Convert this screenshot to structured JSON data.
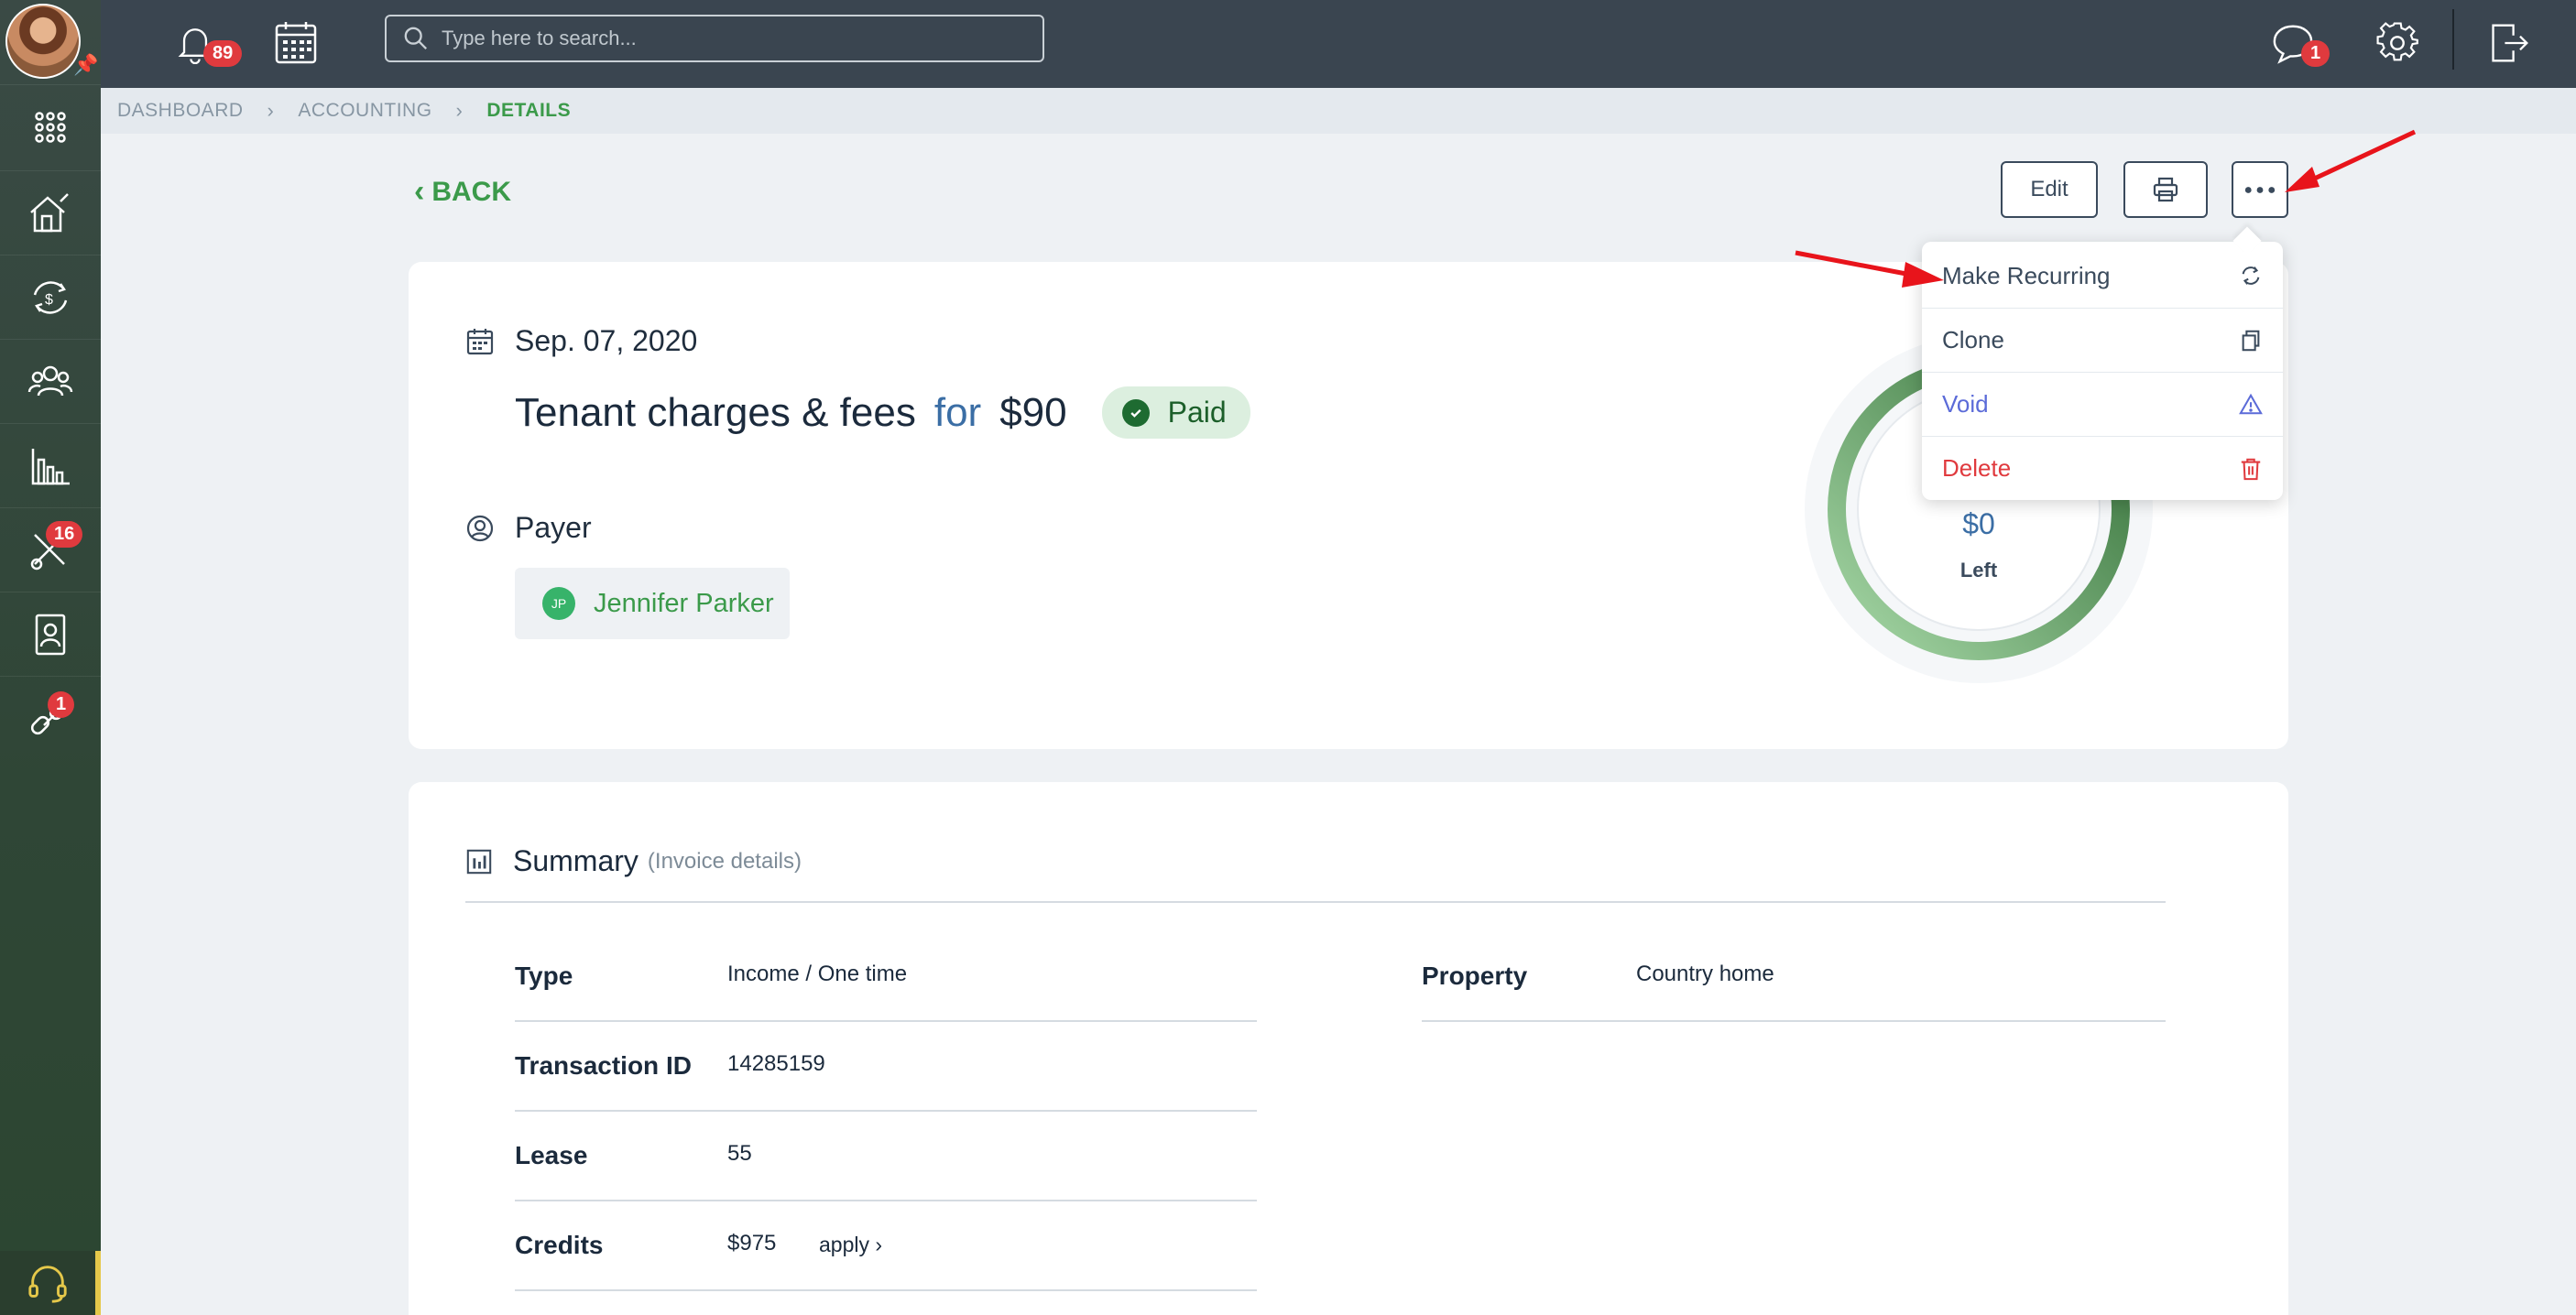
{
  "topbar": {
    "notifications_count": "89",
    "search_placeholder": "Type here to search...",
    "messages_count": "1"
  },
  "sidebar": {
    "badges": {
      "tools": "16",
      "link": "1"
    }
  },
  "breadcrumb": [
    "DASHBOARD",
    "ACCOUNTING",
    "DETAILS"
  ],
  "actions": {
    "back_label": "BACK",
    "edit_label": "Edit"
  },
  "invoice": {
    "date": "Sep. 07, 2020",
    "title": "Tenant charges & fees",
    "for_word": "for",
    "amount": "$90",
    "status": "Paid",
    "payer_heading": "Payer",
    "payer_initials": "JP",
    "payer_name": "Jennifer Parker",
    "left_value": "$0",
    "left_label": "Left"
  },
  "menu": {
    "items": [
      {
        "label": "Make Recurring",
        "icon": "refresh-icon",
        "color": "#3a4a5c"
      },
      {
        "label": "Clone",
        "icon": "copy-icon",
        "color": "#3a4a5c"
      },
      {
        "label": "Void",
        "icon": "warning-icon",
        "color": "#5b6bd8"
      },
      {
        "label": "Delete",
        "icon": "trash-icon",
        "color": "#e03a3e"
      }
    ]
  },
  "summary": {
    "title": "Summary",
    "subtitle": "(Invoice details)",
    "fields": [
      {
        "label": "Type",
        "value": "Income / One time"
      },
      {
        "label": "Transaction ID",
        "value": "14285159"
      },
      {
        "label": "Lease",
        "value": "55"
      },
      {
        "label": "Credits",
        "value": "$975",
        "link": "apply"
      }
    ],
    "property_label": "Property",
    "property_value": "Country home"
  },
  "colors": {
    "accent": "#3b9a4a",
    "topbar": "#3a4550",
    "danger": "#e03a3e"
  }
}
